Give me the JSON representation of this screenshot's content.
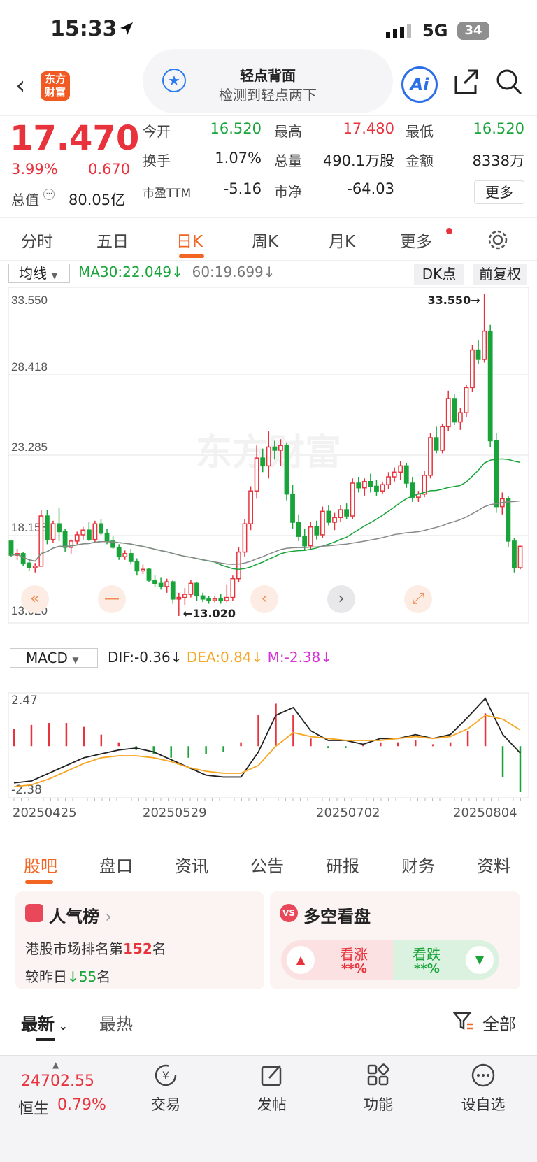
{
  "status": {
    "time": "15:33",
    "network": "5G",
    "battery": "34"
  },
  "nav": {
    "logo_text": "东方财富",
    "tip_title": "轻点背面",
    "tip_sub": "检测到轻点两下",
    "ai_label": "Ai"
  },
  "quote": {
    "price": "17.470",
    "change_pct": "3.99%",
    "change": "0.670",
    "mcap_label": "总值",
    "mcap_value": "80.05亿",
    "fields": {
      "open_l": "今开",
      "open_v": "16.520",
      "high_l": "最高",
      "high_v": "17.480",
      "low_l": "最低",
      "low_v": "16.520",
      "turn_l": "换手",
      "turn_v": "1.07%",
      "vol_l": "总量",
      "vol_v": "490.1万股",
      "amt_l": "金额",
      "amt_v": "8338万",
      "pe_l": "市盈TTM",
      "pe_v": "-5.16",
      "pb_l": "市净",
      "pb_v": "-64.03"
    },
    "more_label": "更多"
  },
  "tabs": [
    "分时",
    "五日",
    "日K",
    "周K",
    "月K",
    "更多"
  ],
  "chart": {
    "ma_select": "均线",
    "ma30": "MA30:22.049",
    "ma60": "60:19.699",
    "dk": "DK点",
    "adjust": "前复权",
    "y_labels": [
      "33.550",
      "28.418",
      "23.285",
      "18.153",
      "13.020"
    ],
    "max_annot": "33.550",
    "min_annot": "13.020",
    "watermark": "东方财富",
    "macd_select": "MACD",
    "dif": "DIF:-0.36",
    "dea": "DEA:0.84",
    "m": "M:-2.38",
    "macd_y": [
      "2.47",
      "-2.38"
    ],
    "dates": [
      "20250425",
      "20250529",
      "20250702",
      "20250804"
    ],
    "colors": {
      "up": "#e8323c",
      "down": "#19a43a",
      "ma30": "#19a43a",
      "ma60": "#888888",
      "dea": "#f5a623",
      "m": "#d633d6"
    }
  },
  "chart_data": {
    "type": "candlestick",
    "ylim": [
      13.02,
      33.55
    ],
    "candles": [
      [
        17.8,
        17.8,
        16.8,
        16.9
      ],
      [
        16.9,
        17.3,
        16.6,
        17.0
      ],
      [
        17.0,
        17.1,
        16.2,
        16.4
      ],
      [
        16.4,
        16.6,
        15.9,
        16.1
      ],
      [
        16.1,
        16.4,
        15.8,
        16.2
      ],
      [
        16.2,
        19.8,
        16.2,
        19.4
      ],
      [
        19.4,
        19.8,
        17.6,
        17.9
      ],
      [
        17.9,
        19.1,
        17.7,
        18.9
      ],
      [
        18.9,
        19.9,
        17.8,
        18.4
      ],
      [
        18.4,
        18.6,
        17.1,
        17.4
      ],
      [
        17.4,
        17.9,
        17.0,
        17.8
      ],
      [
        17.8,
        18.4,
        17.6,
        18.2
      ],
      [
        18.2,
        18.7,
        17.9,
        18.5
      ],
      [
        18.5,
        19.0,
        17.8,
        17.9
      ],
      [
        17.9,
        19.1,
        17.7,
        18.9
      ],
      [
        18.9,
        19.2,
        18.2,
        18.3
      ],
      [
        18.3,
        18.6,
        17.6,
        17.8
      ],
      [
        17.8,
        18.1,
        17.3,
        17.4
      ],
      [
        17.4,
        17.6,
        16.6,
        16.8
      ],
      [
        16.8,
        17.2,
        16.6,
        17.0
      ],
      [
        17.0,
        17.3,
        16.3,
        16.5
      ],
      [
        16.5,
        16.7,
        15.6,
        15.9
      ],
      [
        15.9,
        16.3,
        15.7,
        16.0
      ],
      [
        16.0,
        16.1,
        15.2,
        15.3
      ],
      [
        15.3,
        15.6,
        14.9,
        15.1
      ],
      [
        15.1,
        15.5,
        14.7,
        14.9
      ],
      [
        14.9,
        15.4,
        14.5,
        15.2
      ],
      [
        15.2,
        15.3,
        13.8,
        14.1
      ],
      [
        14.1,
        14.5,
        13.02,
        14.2
      ],
      [
        14.2,
        14.8,
        13.7,
        14.4
      ],
      [
        14.4,
        15.3,
        14.2,
        15.1
      ],
      [
        15.1,
        15.2,
        14.0,
        14.3
      ],
      [
        14.3,
        14.5,
        13.9,
        14.1
      ],
      [
        14.1,
        14.3,
        13.8,
        14.0
      ],
      [
        14.0,
        14.3,
        13.9,
        14.1
      ],
      [
        14.1,
        14.4,
        13.8,
        14.0
      ],
      [
        14.0,
        15.0,
        13.9,
        14.2
      ],
      [
        14.2,
        15.6,
        14.0,
        15.4
      ],
      [
        15.4,
        17.4,
        15.2,
        17.1
      ],
      [
        17.1,
        19.2,
        16.8,
        18.9
      ],
      [
        18.9,
        21.3,
        18.5,
        21.0
      ],
      [
        21.0,
        23.9,
        20.5,
        23.1
      ],
      [
        23.1,
        23.7,
        22.2,
        22.6
      ],
      [
        22.6,
        24.8,
        21.8,
        23.8
      ],
      [
        23.8,
        24.2,
        23.0,
        23.6
      ],
      [
        23.6,
        24.3,
        22.6,
        23.9
      ],
      [
        23.9,
        24.1,
        20.4,
        20.8
      ],
      [
        20.8,
        21.4,
        18.6,
        19.0
      ],
      [
        19.0,
        19.5,
        17.8,
        18.1
      ],
      [
        18.1,
        18.6,
        17.2,
        17.5
      ],
      [
        17.5,
        19.0,
        17.3,
        18.7
      ],
      [
        18.7,
        19.1,
        17.9,
        18.2
      ],
      [
        18.2,
        20.0,
        18.0,
        19.7
      ],
      [
        19.7,
        20.1,
        18.8,
        19.0
      ],
      [
        19.0,
        19.6,
        18.5,
        19.3
      ],
      [
        19.3,
        20.1,
        19.0,
        19.8
      ],
      [
        19.8,
        20.2,
        19.2,
        19.4
      ],
      [
        19.4,
        21.8,
        19.2,
        21.5
      ],
      [
        21.5,
        21.9,
        20.9,
        21.2
      ],
      [
        21.2,
        21.8,
        20.7,
        21.6
      ],
      [
        21.6,
        22.1,
        20.9,
        21.3
      ],
      [
        21.3,
        21.7,
        20.7,
        21.0
      ],
      [
        21.0,
        21.6,
        20.8,
        21.4
      ],
      [
        21.4,
        22.2,
        21.1,
        21.9
      ],
      [
        21.9,
        22.5,
        21.6,
        22.2
      ],
      [
        22.2,
        22.9,
        21.7,
        22.6
      ],
      [
        22.6,
        22.8,
        21.2,
        21.5
      ],
      [
        21.5,
        21.9,
        20.3,
        20.6
      ],
      [
        20.6,
        21.0,
        20.3,
        20.8
      ],
      [
        20.8,
        22.3,
        20.6,
        22.0
      ],
      [
        22.0,
        24.7,
        21.8,
        24.4
      ],
      [
        24.4,
        25.1,
        23.4,
        23.6
      ],
      [
        23.6,
        25.3,
        23.4,
        25.1
      ],
      [
        25.1,
        27.4,
        24.8,
        26.9
      ],
      [
        26.9,
        27.2,
        25.2,
        25.4
      ],
      [
        25.4,
        26.3,
        24.9,
        26.0
      ],
      [
        26.0,
        27.8,
        25.7,
        27.6
      ],
      [
        27.6,
        30.3,
        27.3,
        30.0
      ],
      [
        30.0,
        30.6,
        29.1,
        29.4
      ],
      [
        29.4,
        33.55,
        29.2,
        31.2
      ],
      [
        31.2,
        31.6,
        23.8,
        24.2
      ],
      [
        24.2,
        24.7,
        19.6,
        20.0
      ],
      [
        20.0,
        20.9,
        19.5,
        20.5
      ],
      [
        20.5,
        20.7,
        17.4,
        17.8
      ],
      [
        17.8,
        18.0,
        15.8,
        16.1
      ],
      [
        16.1,
        17.5,
        16.0,
        17.47
      ]
    ],
    "macd": {
      "dif": [
        -1.9,
        -1.8,
        -1.4,
        -1.0,
        -0.6,
        -0.4,
        -0.2,
        -0.1,
        -0.3,
        -0.7,
        -1.1,
        -1.5,
        -1.6,
        -1.6,
        -0.3,
        1.6,
        2.0,
        0.8,
        0.3,
        0.3,
        0.1,
        0.4,
        0.4,
        0.6,
        0.4,
        0.6,
        1.5,
        2.47,
        0.6,
        -0.36
      ],
      "dea": [
        -2.1,
        -2.0,
        -1.7,
        -1.3,
        -0.9,
        -0.6,
        -0.5,
        -0.5,
        -0.6,
        -0.8,
        -1.1,
        -1.3,
        -1.4,
        -1.4,
        -1.0,
        0.0,
        0.7,
        0.5,
        0.4,
        0.3,
        0.3,
        0.3,
        0.4,
        0.5,
        0.4,
        0.5,
        0.9,
        1.6,
        1.4,
        0.84
      ],
      "m": [
        0.9,
        1.1,
        1.2,
        1.2,
        1.0,
        0.6,
        0.2,
        -0.2,
        -0.4,
        -0.6,
        -0.6,
        -0.4,
        -0.3,
        0.2,
        1.6,
        2.2,
        1.6,
        0.4,
        -0.1,
        -0.1,
        0.1,
        0.2,
        0.2,
        0.3,
        0.1,
        0.2,
        0.8,
        1.7,
        -1.6,
        -2.38
      ]
    }
  },
  "bottom_tabs": [
    "股吧",
    "盘口",
    "资讯",
    "公告",
    "研报",
    "财务",
    "资料"
  ],
  "cards": {
    "popular_title": "人气榜",
    "popular_rank_prefix": "港股市场排名第",
    "popular_rank": "152",
    "popular_rank_suffix": "名",
    "popular_change_prefix": "较昨日",
    "popular_change": "55",
    "popular_change_suffix": "名",
    "ls_title": "多空看盘",
    "bull_label": "看涨",
    "bull_val": "**%",
    "bear_label": "看跌",
    "bear_val": "**%"
  },
  "feed": {
    "latest": "最新",
    "hot": "最热",
    "all": "全部"
  },
  "tabbar": {
    "index_value": "24702.55",
    "index_name": "恒生",
    "index_pct": "0.79%",
    "items": [
      "交易",
      "发帖",
      "功能",
      "设自选"
    ]
  }
}
